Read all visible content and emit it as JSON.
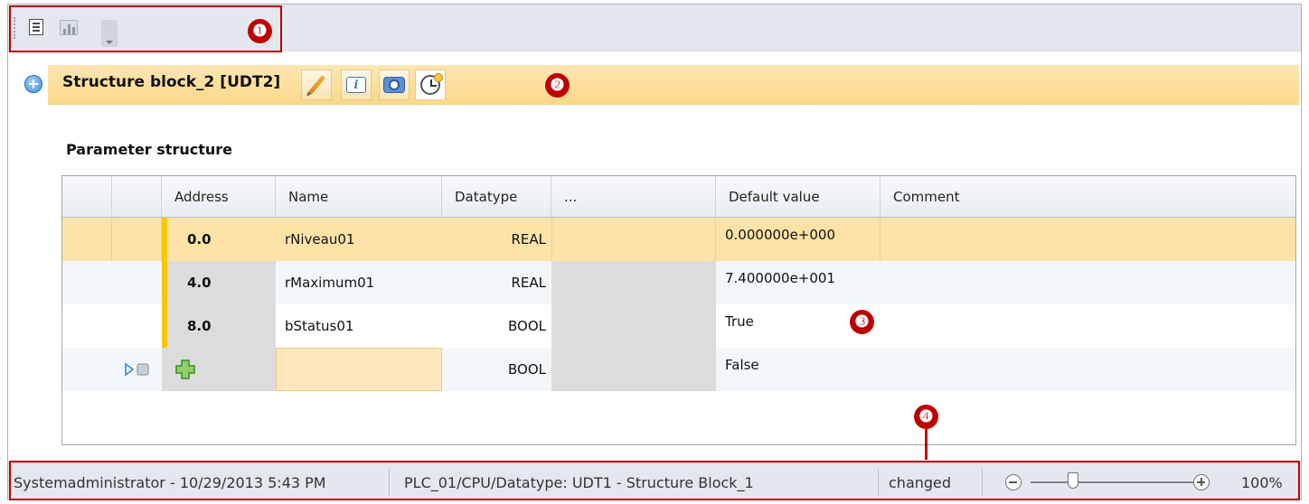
{
  "toolbar": {
    "buttons": [
      {
        "name": "list-view-icon"
      },
      {
        "name": "chart-view-icon"
      },
      {
        "name": "dropdown-icon"
      }
    ]
  },
  "callouts": {
    "one": "❶",
    "two": "❷",
    "three": "❸",
    "four": "❹",
    "color": "#c00000"
  },
  "header": {
    "title": "Structure block_2 [UDT2]",
    "background": "#fbd98a",
    "icons": [
      "expand-icon",
      "edit-pencil-icon",
      "info-icon",
      "properties-icon",
      "history-clock-icon"
    ]
  },
  "section": {
    "title": "Parameter structure"
  },
  "grid": {
    "columns": [
      "",
      "",
      "Address",
      "Name",
      "Datatype",
      "...",
      "Default value",
      "Comment"
    ],
    "rows": [
      {
        "address": "0.0",
        "name": "rNiveau01",
        "datatype": "REAL",
        "default": "0.000000e+000",
        "comment": "",
        "selected": true
      },
      {
        "address": "4.0",
        "name": "rMaximum01",
        "datatype": "REAL",
        "default": "7.400000e+001",
        "comment": ""
      },
      {
        "address": "8.0",
        "name": "bStatus01",
        "datatype": "BOOL",
        "default": "True",
        "comment": ""
      },
      {
        "address": "",
        "name": "",
        "datatype": "BOOL",
        "default": "False",
        "comment": "",
        "is_new_row": true
      }
    ],
    "selected_row_color": "#fde3a7",
    "readonly_cell_color": "#dcdcdc"
  },
  "statusbar": {
    "user": "Systemadministrator - 10/29/2013 5:43 PM",
    "path": "PLC_01/CPU/Datatype: UDT1 - Structure Block_1",
    "state": "changed",
    "zoom": "100%",
    "zoom_level_fraction": 0.25
  }
}
